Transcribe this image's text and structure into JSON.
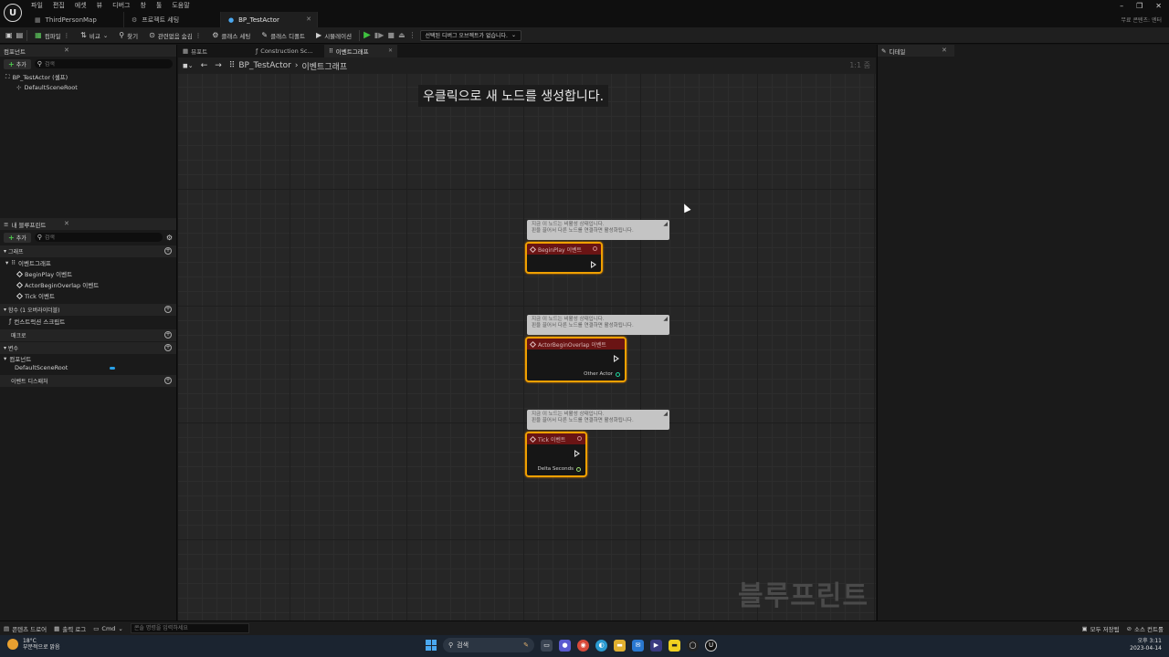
{
  "app": {
    "logo": "U",
    "menu": [
      "파일",
      "편집",
      "에셋",
      "뷰",
      "디버그",
      "창",
      "툴",
      "도움말"
    ],
    "tabs": [
      {
        "label": "ThirdPersonMap",
        "icon": "map-icon"
      },
      {
        "label": "프로젝트 세팅",
        "icon": "gear-icon"
      },
      {
        "label": "BP_TestActor",
        "icon": "blueprint-icon"
      }
    ],
    "window_controls": [
      "–",
      "❐",
      "✕"
    ],
    "source_control": "무료 콘텐츠: 엔터"
  },
  "toolbar": {
    "compile": "컴파일",
    "diff": "비교",
    "find": "찾기",
    "hide_unrelated": "관련없음 숨김",
    "class_settings": "클래스 세팅",
    "class_defaults": "클래스 디폴트",
    "simulation": "시뮬레이션",
    "debug_object": "선택된 디버그 오브젝트가 없습니다."
  },
  "components": {
    "tab": "컴포넌트",
    "add": "추가",
    "search_placeholder": "검색",
    "root": "BP_TestActor (셀프)",
    "child": "DefaultSceneRoot"
  },
  "my_blueprint": {
    "tab": "내 블루프린트",
    "add": "추가",
    "search_placeholder": "검색",
    "graphs_header": "그래프",
    "event_graph": "이벤트그래프",
    "events": [
      "BeginPlay 이벤트",
      "ActorBeginOverlap 이벤트",
      "Tick 이벤트"
    ],
    "functions_header": "함수 (1 오버라이더블)",
    "construction_script": "컨스트럭션 스크립트",
    "macros_header": "매크로",
    "variables_header": "변수",
    "components_header": "컴포넌트",
    "component_var": "DefaultSceneRoot",
    "dispatchers_header": "이벤트 디스패처"
  },
  "center": {
    "tabs": [
      "뷰포트",
      "Construction Sc...",
      "이벤트그래프"
    ],
    "breadcrumb_root": "BP_TestActor",
    "breadcrumb_current": "이벤트그래프",
    "zoom": "1:1 줌",
    "hint": "우클릭으로 새 노드를 생성합니다.",
    "watermark": "블루프린트",
    "comment_text_line1": "지금 이 노드는 비활성 상태입니다.",
    "comment_text_line2": "핀을 끌어서 다른 노드를 연결하면 활성화됩니다.",
    "nodes": [
      {
        "title": "BeginPlay 이벤트",
        "output": ""
      },
      {
        "title": "ActorBeginOverlap 이벤트",
        "output": "Other Actor"
      },
      {
        "title": "Tick 이벤트",
        "output": "Delta Seconds"
      }
    ]
  },
  "details": {
    "tab": "디테일"
  },
  "status": {
    "content_drawer": "콘텐츠 드로어",
    "output_log": "출력 로그",
    "cmd": "Cmd",
    "cmd_placeholder": "콘솔 명령을 입력하세요",
    "save_all": "모두 저장됨",
    "source_control": "소스 컨트롤"
  },
  "taskbar": {
    "temp": "18°C",
    "weather": "부분적으로 맑음",
    "search": "검색",
    "time": "오후 3:11",
    "date": "2023-04-14"
  }
}
